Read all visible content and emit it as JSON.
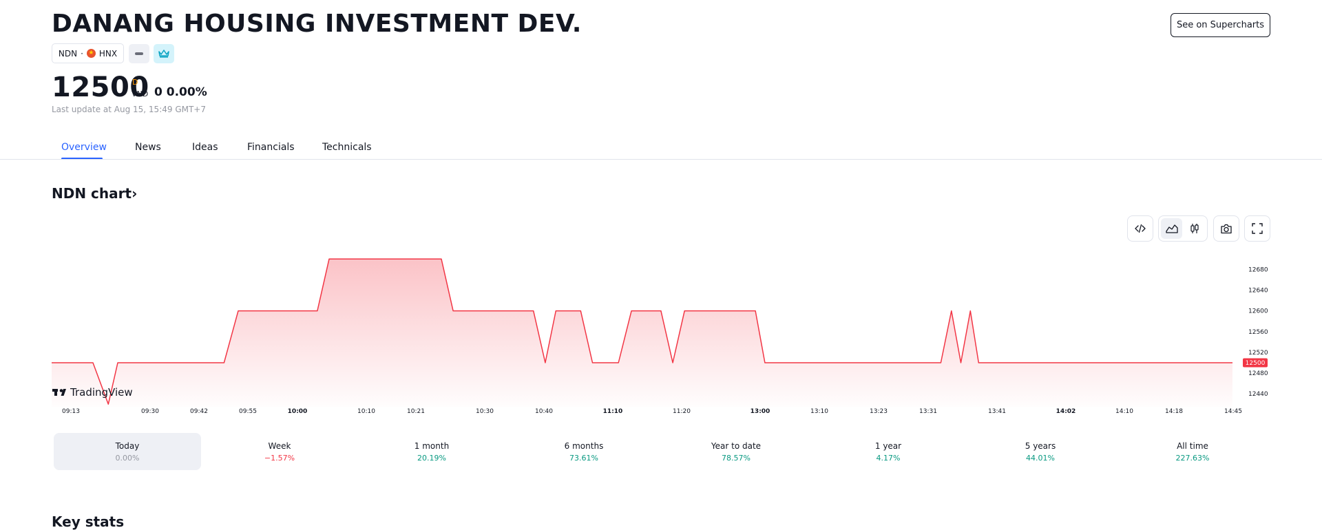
{
  "header": {
    "title": "DANANG HOUSING INVESTMENT DEV.",
    "see_supercharts": "See on Supercharts",
    "ticker": "NDN",
    "separator": "·",
    "exchange": "HNX",
    "icons": [
      "vietnam-flag-icon",
      "pill-icon",
      "crown-icon"
    ]
  },
  "price": {
    "value": "12500",
    "superscript": "D",
    "currency": "VND",
    "change": "0 0.00%",
    "last_update": "Last update at Aug 15, 15:49 GMT+7"
  },
  "tabs": [
    {
      "label": "Overview",
      "active": true
    },
    {
      "label": "News"
    },
    {
      "label": "Ideas"
    },
    {
      "label": "Financials"
    },
    {
      "label": "Technicals"
    }
  ],
  "chart_section": {
    "heading": "NDN chart",
    "heading_chevron": "›",
    "watermark": "TradingView",
    "toolbar_icons": [
      "embed-code-icon",
      "area-chart-icon",
      "candles-icon",
      "camera-icon",
      "fullscreen-icon"
    ]
  },
  "chart_data": {
    "type": "area",
    "line_color": "#f23645",
    "current_price_label": "12500",
    "ylim": [
      12415,
      12715
    ],
    "y_ticks": [
      12680,
      12640,
      12600,
      12560,
      12520,
      12480,
      12440
    ],
    "x_ticks": [
      {
        "label": "09:13",
        "bold": false
      },
      {
        "label": "09:30",
        "bold": false
      },
      {
        "label": "09:42",
        "bold": false
      },
      {
        "label": "09:55",
        "bold": false
      },
      {
        "label": "10:00",
        "bold": true
      },
      {
        "label": "10:10",
        "bold": false
      },
      {
        "label": "10:21",
        "bold": false
      },
      {
        "label": "10:30",
        "bold": false
      },
      {
        "label": "10:40",
        "bold": false
      },
      {
        "label": "11:10",
        "bold": true
      },
      {
        "label": "11:20",
        "bold": false
      },
      {
        "label": "13:00",
        "bold": true
      },
      {
        "label": "13:10",
        "bold": false
      },
      {
        "label": "13:23",
        "bold": false
      },
      {
        "label": "13:31",
        "bold": false
      },
      {
        "label": "13:41",
        "bold": false
      },
      {
        "label": "14:02",
        "bold": true
      },
      {
        "label": "14:10",
        "bold": false
      },
      {
        "label": "14:18",
        "bold": false
      },
      {
        "label": "14:45",
        "bold": false
      }
    ],
    "points": [
      [
        0,
        12500
      ],
      [
        3.5,
        12500
      ],
      [
        4.8,
        12420
      ],
      [
        5.6,
        12500
      ],
      [
        14.6,
        12500
      ],
      [
        15.8,
        12600
      ],
      [
        22.5,
        12600
      ],
      [
        23.5,
        12700
      ],
      [
        33.0,
        12700
      ],
      [
        34.0,
        12600
      ],
      [
        40.8,
        12600
      ],
      [
        41.8,
        12500
      ],
      [
        42.7,
        12600
      ],
      [
        44.8,
        12600
      ],
      [
        45.8,
        12500
      ],
      [
        48.0,
        12500
      ],
      [
        49.1,
        12600
      ],
      [
        51.6,
        12600
      ],
      [
        52.6,
        12500
      ],
      [
        53.6,
        12600
      ],
      [
        59.6,
        12600
      ],
      [
        60.4,
        12500
      ],
      [
        75.3,
        12500
      ],
      [
        76.2,
        12600
      ],
      [
        77.0,
        12500
      ],
      [
        77.8,
        12600
      ],
      [
        78.5,
        12500
      ],
      [
        100,
        12500
      ]
    ]
  },
  "performance": [
    {
      "label": "Today",
      "value": "0.00%",
      "trend": "neutral",
      "active": true
    },
    {
      "label": "Week",
      "value": "−1.57%",
      "trend": "down"
    },
    {
      "label": "1 month",
      "value": "20.19%",
      "trend": "up"
    },
    {
      "label": "6 months",
      "value": "73.61%",
      "trend": "up"
    },
    {
      "label": "Year to date",
      "value": "78.57%",
      "trend": "up"
    },
    {
      "label": "1 year",
      "value": "4.17%",
      "trend": "up"
    },
    {
      "label": "5 years",
      "value": "44.01%",
      "trend": "up"
    },
    {
      "label": "All time",
      "value": "227.63%",
      "trend": "up"
    }
  ],
  "colors": {
    "up": "#089981",
    "down": "#f23645",
    "neutral": "#9598a1",
    "accent": "#2962ff"
  },
  "key_stats_heading": "Key stats"
}
